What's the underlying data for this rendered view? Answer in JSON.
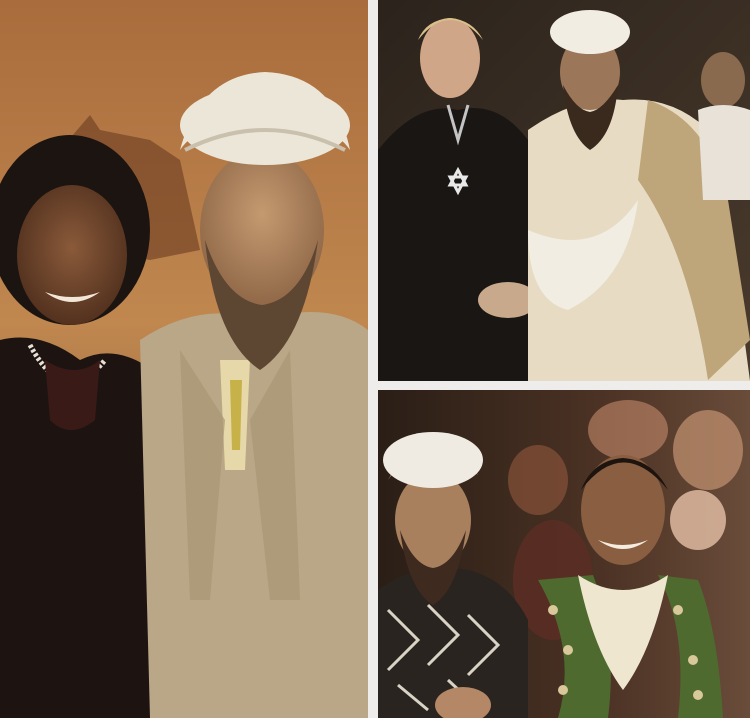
{
  "collage": {
    "panels": [
      {
        "id": "left",
        "subjects": [
          "woman-with-pearl-necklace",
          "man-with-white-turban-and-beard"
        ]
      },
      {
        "id": "top-right",
        "subjects": [
          "woman-with-star-pendant",
          "man-with-white-turban-shaking-hands"
        ]
      },
      {
        "id": "bottom-right",
        "subjects": [
          "man-with-white-turban-and-patterned-scarf",
          "smiling-man-with-flower-garland",
          "crowd"
        ]
      }
    ],
    "colors": {
      "background": "#efedeb",
      "warm_backdrop": "#b8753a",
      "dark_backdrop": "#2b231c",
      "turban_white": "#ece6d8",
      "suit_tan": "#b9a787"
    }
  }
}
